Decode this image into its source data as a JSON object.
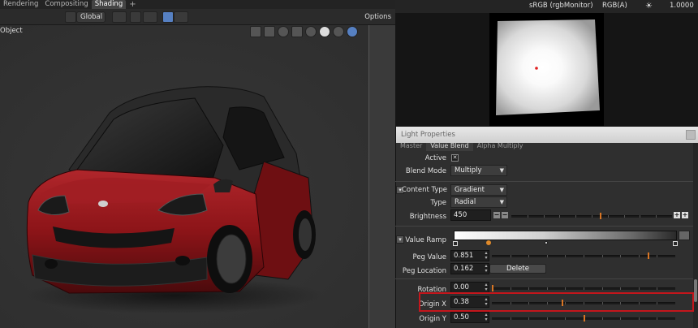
{
  "workspace_tabs": [
    {
      "label": "Rendering",
      "active": false
    },
    {
      "label": "Compositing",
      "active": false
    },
    {
      "label": "Shading",
      "active": true
    }
  ],
  "viewport_header": {
    "transform_orientation": "Global",
    "options_label": "Options"
  },
  "viewport": {
    "mode_label": "Object",
    "car_body_color": "#8c1418"
  },
  "color_bar": {
    "colorspace": "sRGB (rgbMonitor)",
    "channel": "RGB(A)",
    "exposure": "1.0000"
  },
  "light_panel": {
    "title": "Light Properties",
    "tabs": [
      "Master",
      "Value Blend",
      "Alpha Multiply"
    ],
    "active_tab": "Value Blend",
    "active": {
      "label": "Active",
      "checked": true,
      "mark": "✕"
    },
    "blend_mode": {
      "label": "Blend Mode",
      "value": "Multiply"
    },
    "content_type": {
      "label": "Content Type",
      "value": "Gradient"
    },
    "type": {
      "label": "Type",
      "value": "Radial"
    },
    "brightness": {
      "label": "Brightness",
      "value": "450",
      "slider_fraction": 0.55
    },
    "value_ramp": {
      "label": "Value Ramp"
    },
    "peg_value": {
      "label": "Peg Value",
      "value": "0.851",
      "slider_fraction": 0.851
    },
    "peg_location": {
      "label": "Peg Location",
      "value": "0.162",
      "button": "Delete"
    },
    "rotation": {
      "label": "Rotation",
      "value": "0.00",
      "slider_fraction": 0.0
    },
    "origin_x": {
      "label": "Origin X",
      "value": "0.38",
      "slider_fraction": 0.38
    },
    "origin_y": {
      "label": "Origin Y",
      "value": "0.50",
      "slider_fraction": 0.5
    }
  },
  "colors": {
    "accent": "#d87524",
    "selection_blue": "#5680c2",
    "highlight_box": "#c4161c"
  }
}
